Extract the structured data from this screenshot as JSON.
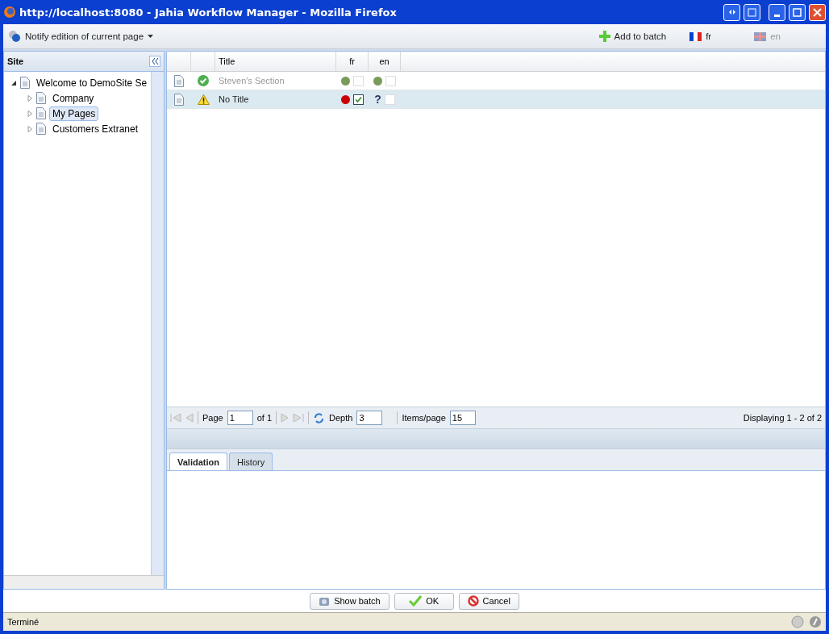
{
  "window": {
    "title": "http://localhost:8080 - Jahia Workflow Manager - Mozilla Firefox"
  },
  "toolbar": {
    "notify": "Notify edition of current page",
    "add_to_batch": "Add to batch",
    "languages": [
      {
        "label": "fr",
        "disabled": false
      },
      {
        "label": "en",
        "disabled": true
      }
    ]
  },
  "sidebar": {
    "title": "Site",
    "tree": [
      {
        "label": "Welcome to DemoSite Se",
        "expanded": true,
        "selected": false,
        "children": [
          {
            "label": "Company",
            "expanded": false,
            "selected": false
          },
          {
            "label": "My Pages",
            "expanded": false,
            "selected": true
          },
          {
            "label": "Customers Extranet",
            "expanded": false,
            "selected": false
          }
        ]
      }
    ]
  },
  "table": {
    "columns": [
      "Title",
      "fr",
      "en"
    ],
    "rows": [
      {
        "title": "Steven's Section",
        "kind": "ok",
        "selected": false,
        "disabled": true,
        "langs": [
          {
            "kind": "dot",
            "color": "#7a9a5a",
            "checked": false
          },
          {
            "kind": "dot",
            "color": "#7a9a5a",
            "checked": false
          }
        ]
      },
      {
        "title": "No Title",
        "kind": "warning",
        "selected": true,
        "disabled": false,
        "langs": [
          {
            "kind": "dot",
            "color": "#cc0000",
            "checked": true
          },
          {
            "kind": "text",
            "text": "?",
            "checked": false
          }
        ]
      }
    ]
  },
  "paging": {
    "page_label": "Page",
    "page": "1",
    "of": "of 1",
    "depth_label": "Depth",
    "depth": "3",
    "items_label": "Items/page",
    "items": "15",
    "displaying": "Displaying 1 - 2 of 2"
  },
  "tabs": [
    {
      "label": "Validation",
      "selected": true
    },
    {
      "label": "History",
      "selected": false
    }
  ],
  "buttons": [
    {
      "kind": "batch",
      "label": "Show batch"
    },
    {
      "kind": "ok",
      "label": "OK"
    },
    {
      "kind": "cancel",
      "label": "Cancel"
    }
  ],
  "status_bar": {
    "text": "Terminé"
  }
}
